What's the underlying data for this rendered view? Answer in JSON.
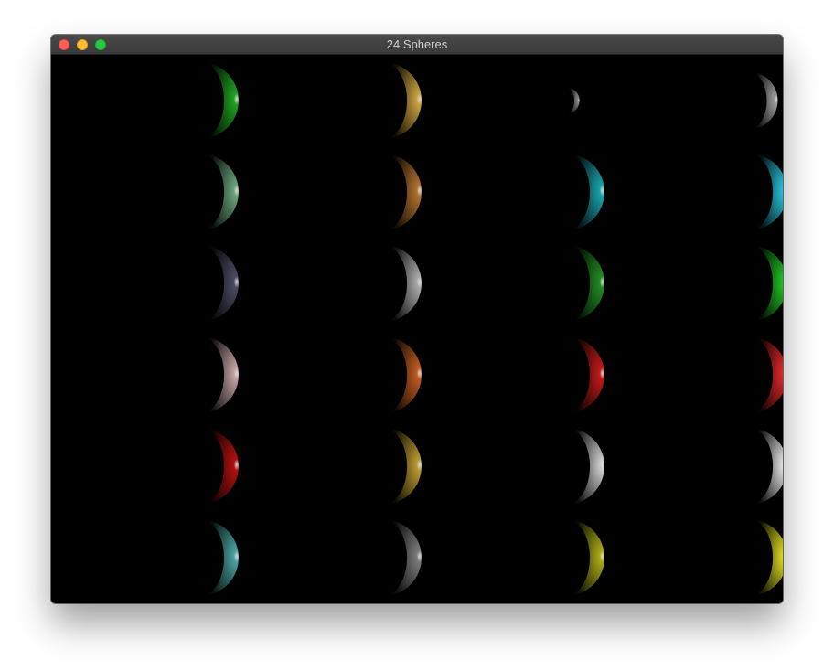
{
  "window": {
    "title": "24 Spheres"
  },
  "spheres": [
    {
      "color": "#1ea01e"
    },
    {
      "color": "#c8a040"
    },
    {
      "color": "#8a8a8a"
    },
    {
      "color": "#9a9a9a"
    },
    {
      "color": "#6aa27a"
    },
    {
      "color": "#b0702e"
    },
    {
      "color": "#1aa0a8"
    },
    {
      "color": "#28c0d8"
    },
    {
      "color": "#4a4a60"
    },
    {
      "color": "#a8a8a8"
    },
    {
      "color": "#228a22"
    },
    {
      "color": "#20c020"
    },
    {
      "color": "#c0a0a0"
    },
    {
      "color": "#c05a20"
    },
    {
      "color": "#c01818"
    },
    {
      "color": "#e02828"
    },
    {
      "color": "#b01010"
    },
    {
      "color": "#b89830"
    },
    {
      "color": "#c8c8c8"
    },
    {
      "color": "#e0e0e0"
    },
    {
      "color": "#4aa0a0"
    },
    {
      "color": "#7a7a7a"
    },
    {
      "color": "#a8a818"
    },
    {
      "color": "#d8d820"
    }
  ]
}
